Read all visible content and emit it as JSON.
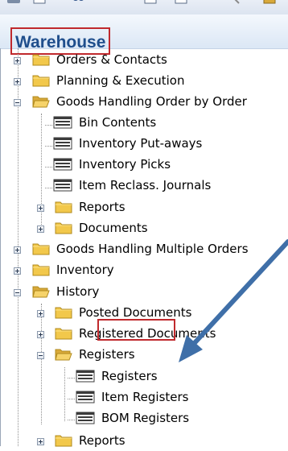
{
  "panel": {
    "title": "Warehouse"
  },
  "tree": {
    "orders_contacts": "Orders & Contacts",
    "planning_execution": "Planning & Execution",
    "goods_handling_order": "Goods Handling Order by Order",
    "bin_contents": "Bin Contents",
    "inventory_putaways": "Inventory Put-aways",
    "inventory_picks": "Inventory Picks",
    "item_reclass": "Item Reclass. Journals",
    "reports": "Reports",
    "documents": "Documents",
    "goods_handling_multiple": "Goods Handling Multiple Orders",
    "inventory": "Inventory",
    "history": "History",
    "posted_documents": "Posted Documents",
    "registered_documents": "Registered Documents",
    "registers_folder": "Registers",
    "registers": "Registers",
    "item_registers": "Item Registers",
    "bom_registers": "BOM Registers",
    "reports_bottom": "Reports"
  },
  "colors": {
    "title": "#1f4e8c",
    "highlight_border": "#c0292d",
    "arrow": "#3f6fa8",
    "folder": "#f2c84b"
  },
  "icons": [
    "folder-icon",
    "open-folder-icon",
    "list-icon",
    "expand-icon",
    "collapse-icon"
  ]
}
